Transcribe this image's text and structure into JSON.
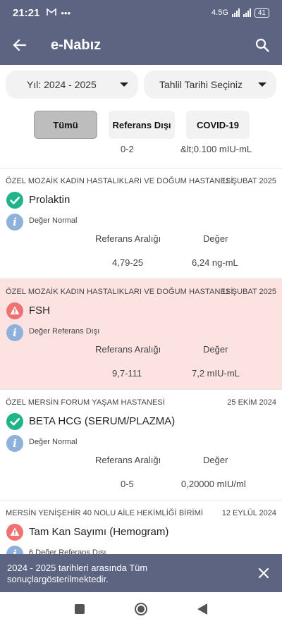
{
  "status_bar": {
    "time": "21:21",
    "network": "4.5G",
    "battery": "41"
  },
  "app_bar": {
    "title": "e-Nabız"
  },
  "filters": {
    "year_label": "Yıl: 2024 - 2025",
    "date_label": "Tahlil Tarihi Seçiniz"
  },
  "tabs": [
    {
      "label": "Tümü",
      "active": true
    },
    {
      "label": "Referans Dışı",
      "active": false
    },
    {
      "label": "COVID-19",
      "active": false
    }
  ],
  "partial_result": {
    "range": "0-2",
    "value": "&lt;0.100 mIU-mL"
  },
  "results": [
    {
      "hospital": "ÖZEL MOZAİK KADIN HASTALIKLARI VE DOĞUM HASTANESİ",
      "date": "11 ŞUBAT 2025",
      "test": "Prolaktin",
      "status": "normal",
      "note": "Değer Normal",
      "range_label": "Referans Aralığı",
      "value_label": "Değer",
      "range": "4,79-25",
      "value": "6,24 ng-mL"
    },
    {
      "hospital": "ÖZEL MOZAİK KADIN HASTALIKLARI VE DOĞUM HASTANESİ",
      "date": "11 ŞUBAT 2025",
      "test": "FSH",
      "status": "out",
      "note": "Değer Referans Dışı",
      "range_label": "Referans Aralığı",
      "value_label": "Değer",
      "range": "9,7-111",
      "value": "7,2 mIU-mL"
    },
    {
      "hospital": "ÖZEL MERSİN FORUM YAŞAM HASTANESİ",
      "date": "25 EKİM 2024",
      "test": "BETA HCG (SERUM/PLAZMA)",
      "status": "normal",
      "note": "Değer Normal",
      "range_label": "Referans Aralığı",
      "value_label": "Değer",
      "range": "0-5",
      "value": "0,20000 mIU/ml"
    },
    {
      "hospital": "MERSİN YENİŞEHİR 40 NOLU AİLE HEKİMLİĞİ BİRİMİ",
      "date": "12 EYLÜL 2024",
      "test": "Tam Kan Sayımı (Hemogram)",
      "status": "out",
      "note": "6 Değer Referans Dışı",
      "range_label": "",
      "value_label": "",
      "range": "",
      "value": ""
    }
  ],
  "snackbar": {
    "message": "2024 - 2025 tarihleri arasında Tüm sonuçlargösterilmektedir."
  },
  "colors": {
    "primary": "#5d6482",
    "normal": "#1fb489",
    "warning": "#ef7272",
    "info": "#8db1da",
    "out_bg": "#fde2e2"
  }
}
